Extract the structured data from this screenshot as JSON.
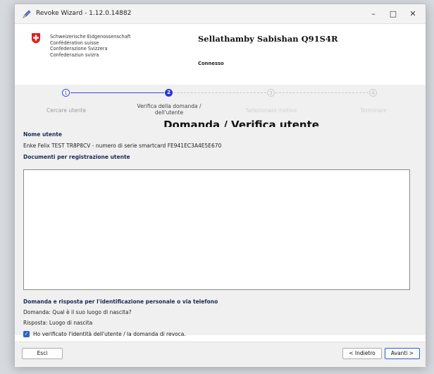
{
  "window": {
    "title": "Revoke Wizard - 1.12.0.14882",
    "minimize": "–",
    "maximize": "□",
    "close": "✕"
  },
  "header": {
    "confederation": [
      "Schweizerische Eidgenossenschaft",
      "Confédération suisse",
      "Confederazione Svizzera",
      "Confederaziun svizra"
    ],
    "user_name": "Sellathamby Sabishan Q91S4R",
    "status": "Connesso"
  },
  "steps": [
    {
      "number": "1",
      "label": "Cercare utente",
      "state": "done"
    },
    {
      "number": "2",
      "label": "Verifica della domanda / dell'utente",
      "state": "active"
    },
    {
      "number": "3",
      "label": "Selezionare motivo",
      "state": "pending"
    },
    {
      "number": "4",
      "label": "Terminare",
      "state": "pending"
    }
  ],
  "page_title": "Domanda / Verifica utente",
  "content": {
    "username_label": "Nome utente",
    "username_value": "Enke Felix TEST TR8P8CV - numero di serie smartcard FE941EC3A4E5E670",
    "documents_label": "Documenti per registrazione utente",
    "documents_value": "",
    "question_section_label": "Domanda e risposta per l'identificazione personale o via telefono",
    "question_text": "Domanda: Qual è il suo luogo di nascita?",
    "answer_text": "Risposta:   Luogo di nascita",
    "verify_checkbox_label": "Ho verificato l'identità dell'utente / la domanda di revoca.",
    "verify_checked": true
  },
  "footer": {
    "exit_label": "Esci",
    "back_label": "< Indietro",
    "next_label": "Avanti >"
  },
  "colors": {
    "accent": "#2b36d9",
    "swiss_red": "#e0201b",
    "checkbox": "#2b63c6"
  }
}
